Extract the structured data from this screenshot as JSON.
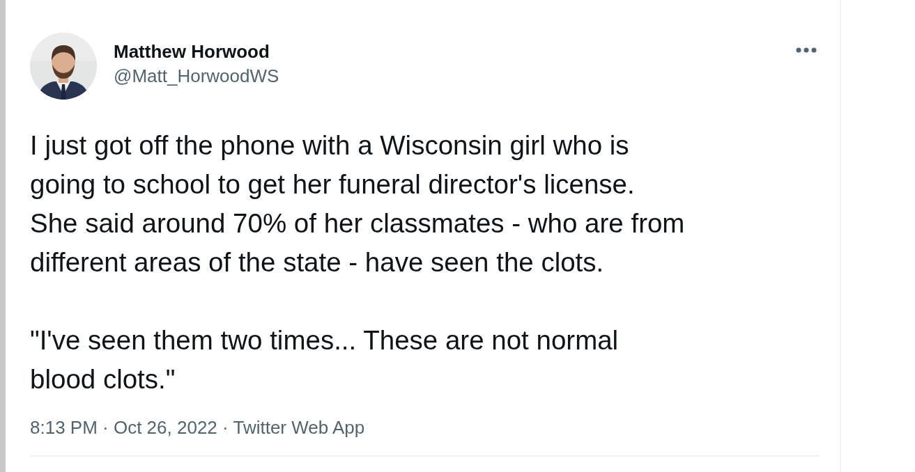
{
  "tweet": {
    "author": {
      "name": "Matthew Horwood",
      "handle": "@Matt_HorwoodWS"
    },
    "paragraphs": [
      [
        "I just got off the phone with a Wisconsin girl who is",
        "going to school to get her funeral director's license.",
        "She said around 70% of her classmates - who are from",
        "different areas of the state - have seen the clots."
      ],
      [
        "\"I've seen them two times... These are not normal",
        "blood clots.\""
      ]
    ],
    "meta": "8:13 PM · Oct 26, 2022 · Twitter Web App"
  }
}
